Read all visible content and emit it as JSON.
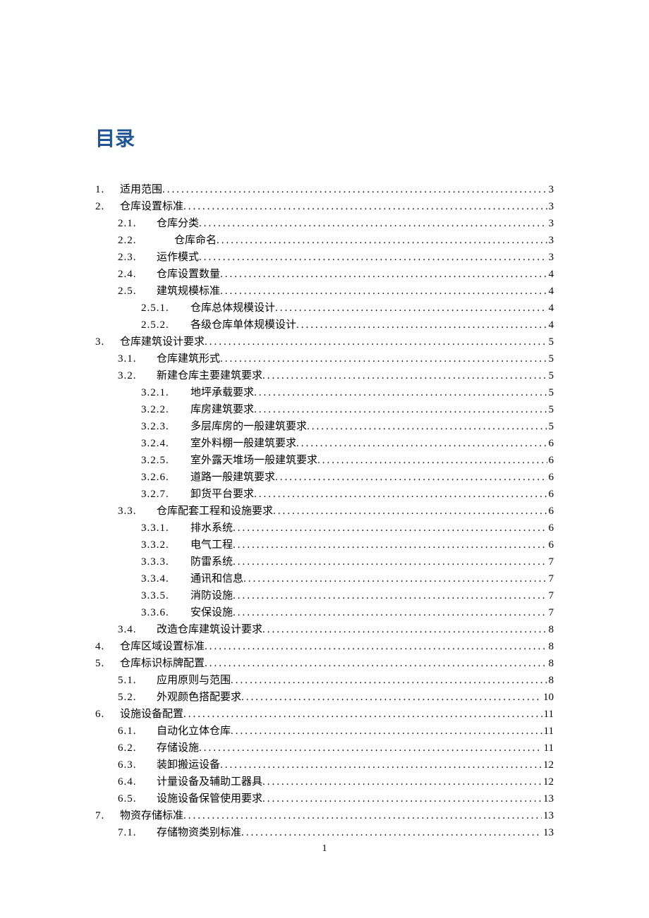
{
  "heading": "目录",
  "page_number": "1",
  "toc": [
    {
      "level": 1,
      "num": "1.",
      "title": "适用范围",
      "page": "3"
    },
    {
      "level": 1,
      "num": "2.",
      "title": "仓库设置标准",
      "page": "3"
    },
    {
      "level": 2,
      "num": "2.1.",
      "title": "仓库分类",
      "page": "3"
    },
    {
      "level": 2,
      "num": "2.2.",
      "title": "仓库命名",
      "page": "3",
      "wide": true
    },
    {
      "level": 2,
      "num": "2.3.",
      "title": "运作模式",
      "page": "3"
    },
    {
      "level": 2,
      "num": "2.4.",
      "title": "仓库设置数量",
      "page": "4"
    },
    {
      "level": 2,
      "num": "2.5.",
      "title": "建筑规模标准",
      "page": "4"
    },
    {
      "level": 3,
      "num": "2.5.1.",
      "title": "仓库总体规模设计",
      "page": "4"
    },
    {
      "level": 3,
      "num": "2.5.2.",
      "title": "各级仓库单体规模设计",
      "page": "4"
    },
    {
      "level": 1,
      "num": "3.",
      "title": "仓库建筑设计要求",
      "page": "5"
    },
    {
      "level": 2,
      "num": "3.1.",
      "title": "仓库建筑形式",
      "page": "5"
    },
    {
      "level": 2,
      "num": "3.2.",
      "title": "新建仓库主要建筑要求",
      "page": "5"
    },
    {
      "level": 3,
      "num": "3.2.1.",
      "title": "地坪承载要求",
      "page": "5"
    },
    {
      "level": 3,
      "num": "3.2.2.",
      "title": "库房建筑要求",
      "page": "5"
    },
    {
      "level": 3,
      "num": "3.2.3.",
      "title": "多层库房的一般建筑要求",
      "page": "5"
    },
    {
      "level": 3,
      "num": "3.2.4.",
      "title": "室外料棚一般建筑要求",
      "page": "6"
    },
    {
      "level": 3,
      "num": "3.2.5.",
      "title": "室外露天堆场一般建筑要求",
      "page": "6"
    },
    {
      "level": 3,
      "num": "3.2.6.",
      "title": "道路一般建筑要求",
      "page": "6"
    },
    {
      "level": 3,
      "num": "3.2.7.",
      "title": "卸货平台要求",
      "page": "6"
    },
    {
      "level": 2,
      "num": "3.3.",
      "title": "仓库配套工程和设施要求",
      "page": "6"
    },
    {
      "level": 3,
      "num": "3.3.1.",
      "title": "排水系统",
      "page": "6"
    },
    {
      "level": 3,
      "num": "3.3.2.",
      "title": "电气工程",
      "page": "6"
    },
    {
      "level": 3,
      "num": "3.3.3.",
      "title": "防雷系统",
      "page": "7"
    },
    {
      "level": 3,
      "num": "3.3.4.",
      "title": "通讯和信息",
      "page": "7"
    },
    {
      "level": 3,
      "num": "3.3.5.",
      "title": "消防设施",
      "page": "7"
    },
    {
      "level": 3,
      "num": "3.3.6.",
      "title": "安保设施",
      "page": "7"
    },
    {
      "level": 2,
      "num": "3.4.",
      "title": "改造仓库建筑设计要求",
      "page": "8"
    },
    {
      "level": 1,
      "num": "4.",
      "title": "仓库区域设置标准",
      "page": "8"
    },
    {
      "level": 1,
      "num": "5.",
      "title": "仓库标识标牌配置",
      "page": "8"
    },
    {
      "level": 2,
      "num": "5.1.",
      "title": "应用原则与范围",
      "page": "8"
    },
    {
      "level": 2,
      "num": "5.2.",
      "title": "外观颜色搭配要求",
      "page": "10"
    },
    {
      "level": 1,
      "num": "6.",
      "title": "设施设备配置",
      "page": "11"
    },
    {
      "level": 2,
      "num": "6.1.",
      "title": "自动化立体仓库",
      "page": "11"
    },
    {
      "level": 2,
      "num": "6.2.",
      "title": "存储设施",
      "page": "11"
    },
    {
      "level": 2,
      "num": "6.3.",
      "title": "装卸搬运设备",
      "page": "12"
    },
    {
      "level": 2,
      "num": "6.4.",
      "title": "计量设备及辅助工器具",
      "page": "12"
    },
    {
      "level": 2,
      "num": "6.5.",
      "title": "设施设备保管使用要求",
      "page": "13"
    },
    {
      "level": 1,
      "num": "7.",
      "title": "物资存储标准",
      "page": "13"
    },
    {
      "level": 2,
      "num": "7.1.",
      "title": "存储物资类别标准",
      "page": "13"
    }
  ]
}
